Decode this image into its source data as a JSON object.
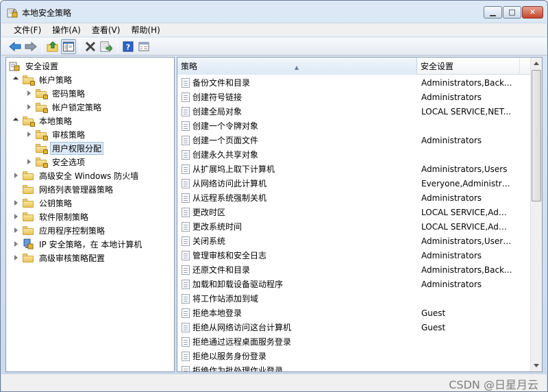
{
  "window": {
    "title": "本地安全策略",
    "minimize": "▭",
    "maximize": "◻",
    "close": "✕"
  },
  "menu": [
    {
      "label": "文件(F)"
    },
    {
      "label": "操作(A)"
    },
    {
      "label": "查看(V)"
    },
    {
      "label": "帮助(H)"
    }
  ],
  "toolbar": {
    "icons": [
      "back-arrow-icon",
      "forward-arrow-icon",
      "up-folder-icon",
      "show-hide-tree-icon",
      "delete-icon",
      "export-list-icon",
      "help-icon",
      "properties-icon"
    ]
  },
  "tree": [
    {
      "label": "安全设置",
      "level": 0,
      "expander": "none",
      "icon": "security-settings-icon"
    },
    {
      "label": "帐户策略",
      "level": 1,
      "expander": "open",
      "icon": "folder-icon"
    },
    {
      "label": "密码策略",
      "level": 2,
      "expander": "closed",
      "icon": "folder-icon"
    },
    {
      "label": "帐户锁定策略",
      "level": 2,
      "expander": "closed",
      "icon": "folder-icon"
    },
    {
      "label": "本地策略",
      "level": 1,
      "expander": "open",
      "icon": "folder-icon"
    },
    {
      "label": "审核策略",
      "level": 2,
      "expander": "closed",
      "icon": "folder-icon"
    },
    {
      "label": "用户权限分配",
      "level": 2,
      "expander": "none",
      "icon": "folder-icon",
      "selected": true
    },
    {
      "label": "安全选项",
      "level": 2,
      "expander": "closed",
      "icon": "folder-icon"
    },
    {
      "label": "高级安全 Windows 防火墙",
      "level": 1,
      "expander": "closed",
      "icon": "folder-icon"
    },
    {
      "label": "网络列表管理器策略",
      "level": 1,
      "expander": "none",
      "icon": "folder-icon"
    },
    {
      "label": "公钥策略",
      "level": 1,
      "expander": "closed",
      "icon": "folder-icon"
    },
    {
      "label": "软件限制策略",
      "level": 1,
      "expander": "closed",
      "icon": "folder-icon"
    },
    {
      "label": "应用程序控制策略",
      "level": 1,
      "expander": "closed",
      "icon": "folder-icon"
    },
    {
      "label": "IP 安全策略，在 本地计算机",
      "level": 1,
      "expander": "closed",
      "icon": "ip-security-icon"
    },
    {
      "label": "高级审核策略配置",
      "level": 1,
      "expander": "closed",
      "icon": "folder-icon"
    }
  ],
  "list": {
    "columns": {
      "policy": "策略",
      "setting": "安全设置"
    },
    "rows": [
      {
        "policy": "备份文件和目录",
        "setting": "Administrators,Backu..."
      },
      {
        "policy": "创建符号链接",
        "setting": "Administrators"
      },
      {
        "policy": "创建全局对象",
        "setting": "LOCAL SERVICE,NET..."
      },
      {
        "policy": "创建一个令牌对象",
        "setting": ""
      },
      {
        "policy": "创建一个页面文件",
        "setting": "Administrators"
      },
      {
        "policy": "创建永久共享对象",
        "setting": ""
      },
      {
        "policy": "从扩展坞上取下计算机",
        "setting": "Administrators,Users"
      },
      {
        "policy": "从网络访问此计算机",
        "setting": "Everyone,Administrat..."
      },
      {
        "policy": "从远程系统强制关机",
        "setting": "Administrators"
      },
      {
        "policy": "更改时区",
        "setting": "LOCAL SERVICE,Admi..."
      },
      {
        "policy": "更改系统时间",
        "setting": "LOCAL SERVICE,Admi..."
      },
      {
        "policy": "关闭系统",
        "setting": "Administrators,Users,..."
      },
      {
        "policy": "管理审核和安全日志",
        "setting": "Administrators"
      },
      {
        "policy": "还原文件和目录",
        "setting": "Administrators,Backu..."
      },
      {
        "policy": "加载和卸载设备驱动程序",
        "setting": "Administrators"
      },
      {
        "policy": "将工作站添加到域",
        "setting": ""
      },
      {
        "policy": "拒绝本地登录",
        "setting": "Guest"
      },
      {
        "policy": "拒绝从网络访问这台计算机",
        "setting": "Guest"
      },
      {
        "policy": "拒绝通过远程桌面服务登录",
        "setting": ""
      },
      {
        "policy": "拒绝以服务身份登录",
        "setting": ""
      },
      {
        "policy": "拒绝作为批处理作业登录",
        "setting": ""
      }
    ]
  },
  "status": {
    "watermark": "CSDN @日星月云"
  }
}
